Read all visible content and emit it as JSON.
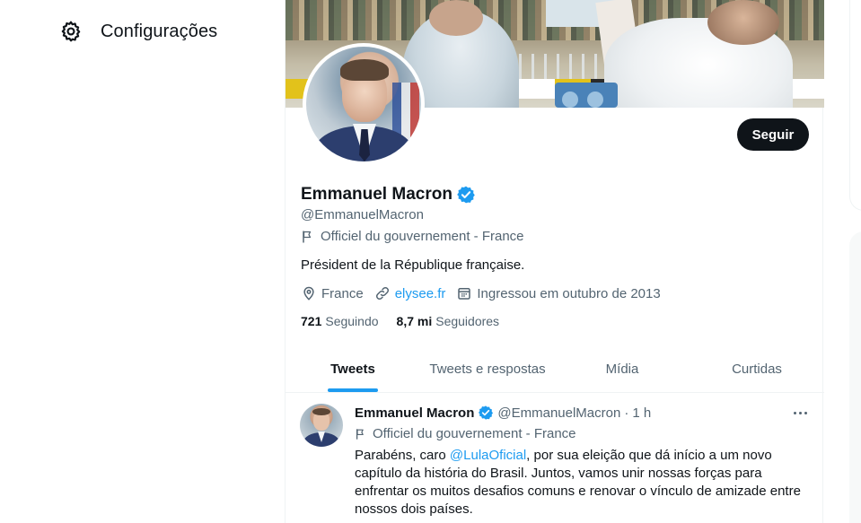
{
  "sidebar": {
    "settings_label": "Configurações",
    "settings_icon": "gear-icon"
  },
  "profile": {
    "display_name": "Emmanuel Macron",
    "handle": "@EmmanuelMacron",
    "affiliation": "Officiel du gouvernement - France",
    "bio": "Président de la République française.",
    "location": "France",
    "website": "elysee.fr",
    "joined": "Ingressou em outubro de 2013",
    "following_count": "721",
    "following_label": "Seguindo",
    "followers_count": "8,7 mi",
    "followers_label": "Seguidores",
    "follow_button": "Seguir",
    "verified_color": "#1d9bf0"
  },
  "tabs": [
    {
      "label": "Tweets",
      "active": true
    },
    {
      "label": "Tweets e respostas",
      "active": false
    },
    {
      "label": "Mídia",
      "active": false
    },
    {
      "label": "Curtidas",
      "active": false
    }
  ],
  "tweet": {
    "author_name": "Emmanuel Macron",
    "author_handle": "@EmmanuelMacron",
    "separator": "·",
    "time": "1 h",
    "affiliation": "Officiel du gouvernement - France",
    "text_before_mention": "Parabéns, caro ",
    "mention": "@LulaOficial",
    "text_after_mention": ", por sua eleição que dá início a um novo capítulo da história do Brasil. Juntos, vamos unir nossas forças para enfrentar os muitos desafios comuns e renovar o vínculo de amizade entre nossos dois países."
  },
  "colors": {
    "accent": "#1d9bf0",
    "text_primary": "#0f1419",
    "text_secondary": "#536471",
    "button_bg": "#0f1419"
  }
}
